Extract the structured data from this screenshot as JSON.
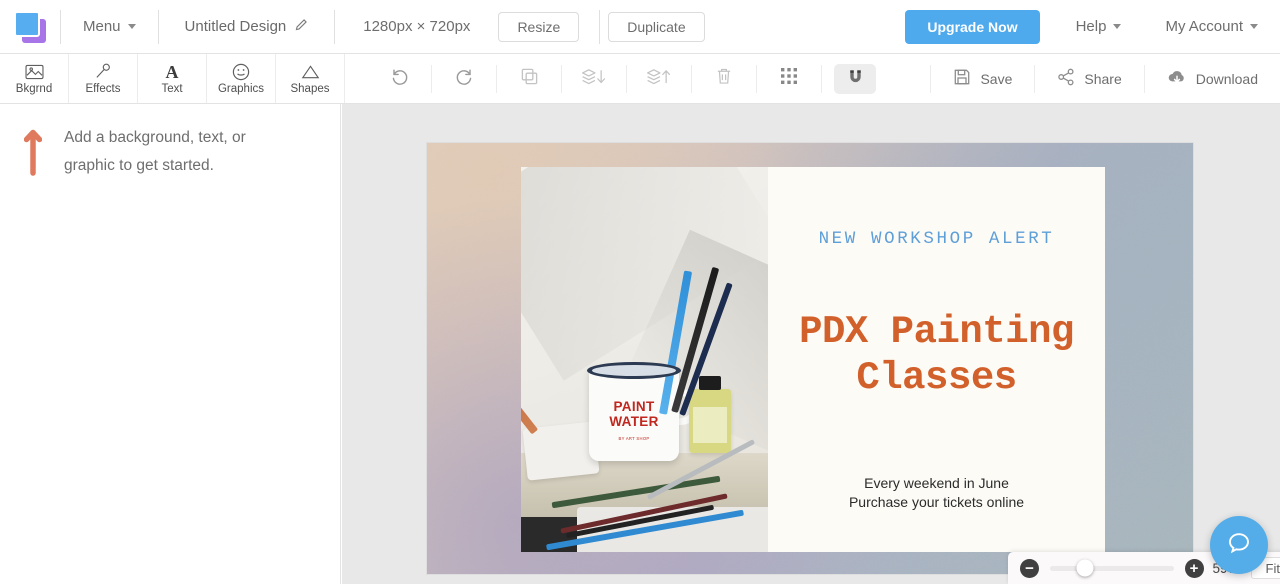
{
  "topbar": {
    "logo_name": "app-logo",
    "menu_label": "Menu",
    "design_title": "Untitled Design",
    "dimensions": "1280px × 720px",
    "resize_label": "Resize",
    "duplicate_label": "Duplicate",
    "upgrade_label": "Upgrade Now",
    "help_label": "Help",
    "account_label": "My Account",
    "accent_blue": "#4ea9ed"
  },
  "toolbar": {
    "left_tools": [
      {
        "label": "Bkgrnd",
        "icon": "image-icon"
      },
      {
        "label": "Effects",
        "icon": "magic-wand-icon"
      },
      {
        "label": "Text",
        "icon": "text-a-icon"
      },
      {
        "label": "Graphics",
        "icon": "smiley-icon"
      },
      {
        "label": "Shapes",
        "icon": "triangle-icon"
      }
    ],
    "center_tools": [
      {
        "name": "undo",
        "icon": "undo-arrow-icon"
      },
      {
        "name": "redo",
        "icon": "redo-arrow-icon"
      },
      {
        "name": "duplicate",
        "icon": "copy-icon"
      },
      {
        "name": "send-backward",
        "icon": "layers-down-icon"
      },
      {
        "name": "bring-forward",
        "icon": "layers-up-icon"
      },
      {
        "name": "delete",
        "icon": "trash-icon"
      },
      {
        "name": "grid",
        "icon": "grid-dots-icon"
      },
      {
        "name": "snap",
        "icon": "magnet-icon",
        "active": true
      }
    ],
    "save_label": "Save",
    "share_label": "Share",
    "download_label": "Download"
  },
  "sidebar": {
    "hint_line1": "Add a background, text, or",
    "hint_line2": "graphic to get started.",
    "arrow_color": "#e07a5f"
  },
  "canvas": {
    "poster": {
      "eyebrow": "NEW WORKSHOP ALERT",
      "eyebrow_color": "#5f9fd8",
      "title_line1": "PDX Painting",
      "title_line2": "Classes",
      "title_color": "#d2602a",
      "sub_line1": "Every weekend in June",
      "sub_line2": "Purchase your tickets online",
      "card_bg": "#fdfbf6"
    },
    "photo": {
      "mug_text_line1": "PAINT",
      "mug_text_line2": "WATER",
      "mug_text_fine": "BY ART SHOP",
      "mug_text_color": "#c0271f"
    }
  },
  "zoombar": {
    "zoom_out_label": "−",
    "zoom_in_label": "+",
    "zoom_percent": "59%",
    "fit_label": "Fit",
    "slider_position_pct": 28
  },
  "help_fab": {
    "icon": "chat-bubble-icon",
    "color": "#54ade9"
  }
}
